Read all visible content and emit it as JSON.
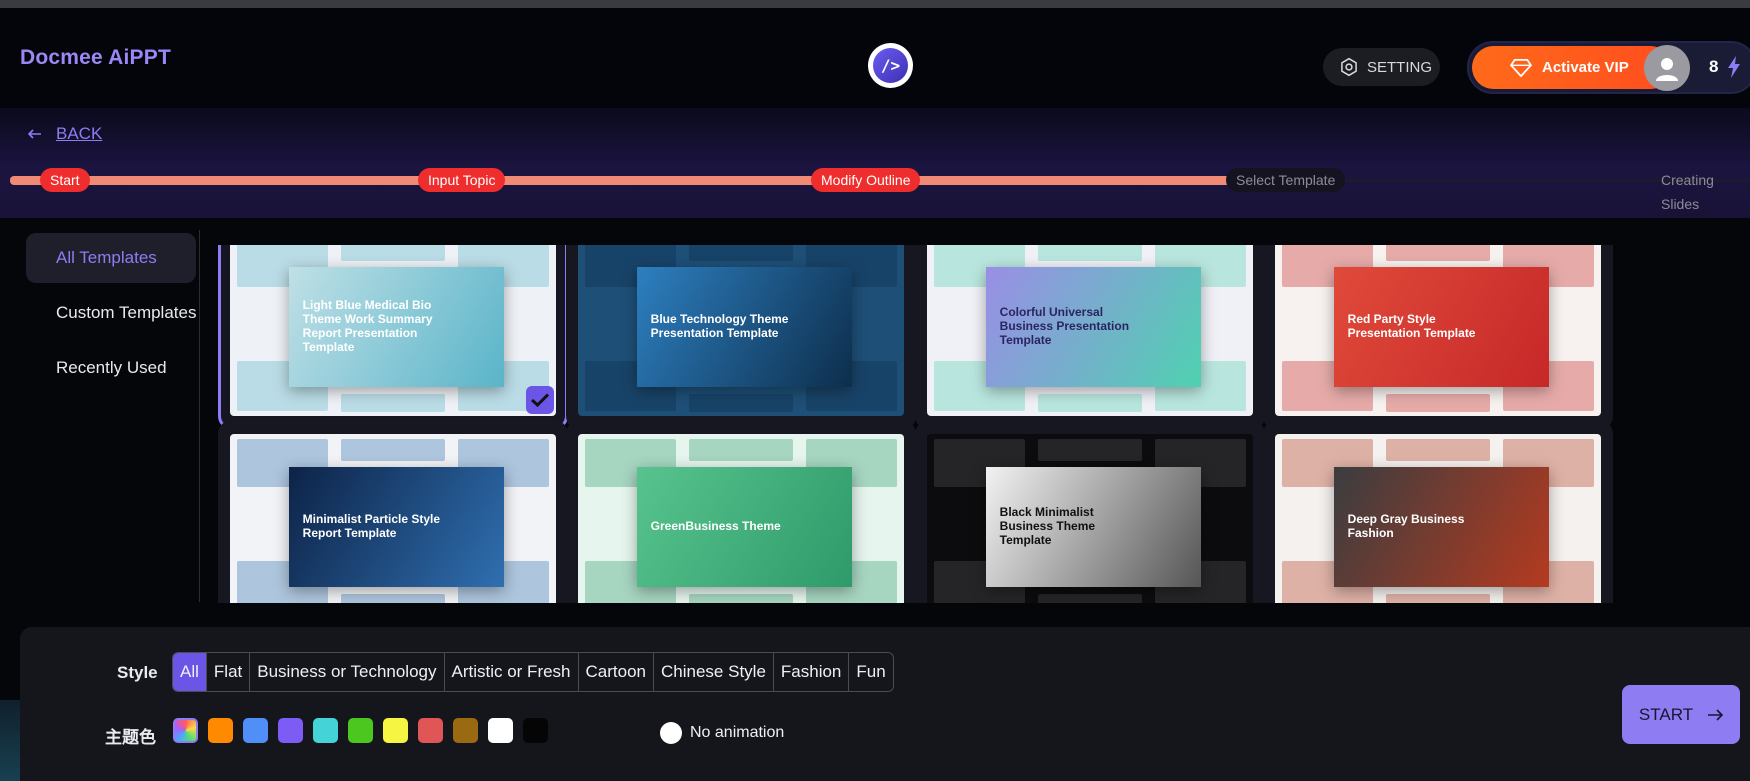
{
  "header": {
    "brand": "Docmee AiPPT",
    "logo_glyph": "/>",
    "setting_label": "SETTING",
    "vip_label": "Activate VIP",
    "credits": "8"
  },
  "nav": {
    "back_label": "BACK"
  },
  "progress": {
    "steps": [
      {
        "label": "Start",
        "state": "done"
      },
      {
        "label": "Input Topic",
        "state": "done"
      },
      {
        "label": "Modify Outline",
        "state": "done"
      },
      {
        "label": "Select Template",
        "state": "current"
      },
      {
        "label": "Creating Slides",
        "state": "todo"
      }
    ]
  },
  "sidebar": {
    "items": [
      {
        "label": "All Templates",
        "active": true
      },
      {
        "label": "Custom Templates",
        "active": false
      },
      {
        "label": "Recently Used",
        "active": false
      }
    ]
  },
  "templates": [
    {
      "title": "Light Blue Medical Bio Theme Work Summary Report Presentation Template",
      "selected": true,
      "bg": "#eef2f6",
      "cover": "#bfe0e6",
      "ink": "#ffffff",
      "accent": "#5ab4c9"
    },
    {
      "title": "Blue Technology Theme Presentation Template",
      "selected": false,
      "bg": "#1e4f77",
      "cover": "#2d7fc0",
      "ink": "#ffffff",
      "accent": "#0d2e4c"
    },
    {
      "title": "Colorful Universal Business Presentation Template",
      "selected": false,
      "bg": "#f0f1f7",
      "cover": "#9a8ee6",
      "ink": "#2a2560",
      "accent": "#4fd1b0"
    },
    {
      "title": "Red Party Style Presentation Template",
      "selected": false,
      "bg": "#f7f2ef",
      "cover": "#e04a3a",
      "ink": "#ffffff",
      "accent": "#c62828"
    },
    {
      "title": "Minimalist Particle Style Report Template",
      "selected": false,
      "bg": "#f2f3f6",
      "cover": "#0d2347",
      "ink": "#ffffff",
      "accent": "#2f6fb0"
    },
    {
      "title": "GreenBusiness Theme",
      "selected": false,
      "bg": "#e6f5ee",
      "cover": "#57c48e",
      "ink": "#ffffff",
      "accent": "#2f9a6a"
    },
    {
      "title": "Black Minimalist Business Theme Template",
      "selected": false,
      "bg": "#0c0c0e",
      "cover": "#f2f2f2",
      "ink": "#111111",
      "accent": "#555555"
    },
    {
      "title": "Deep Gray Business Fashion",
      "selected": false,
      "bg": "#f4f1ee",
      "cover": "#3a3d40",
      "ink": "#ffffff",
      "accent": "#b53a1f"
    }
  ],
  "filters": {
    "style_label": "Style",
    "styles": [
      {
        "label": "All",
        "active": true
      },
      {
        "label": "Flat",
        "active": false
      },
      {
        "label": "Business or Technology",
        "active": false
      },
      {
        "label": "Artistic or Fresh",
        "active": false
      },
      {
        "label": "Cartoon",
        "active": false
      },
      {
        "label": "Chinese Style",
        "active": false
      },
      {
        "label": "Fashion",
        "active": false
      },
      {
        "label": "Fun",
        "active": false
      }
    ],
    "theme_label": "主题色",
    "theme_colors": [
      "rainbow",
      "#ff8a00",
      "#4f8ff7",
      "#7c5cf5",
      "#44d4d8",
      "#4cc71f",
      "#f5f542",
      "#e05555",
      "#9a6a12",
      "#ffffff",
      "#050505"
    ],
    "animation_label": "No animation"
  },
  "actions": {
    "start_label": "START"
  },
  "colors": {
    "accent": "#8d7cf2",
    "progress": "#f08a75",
    "step_badge": "#ef2d2d",
    "vip": "#ff5a1e"
  }
}
